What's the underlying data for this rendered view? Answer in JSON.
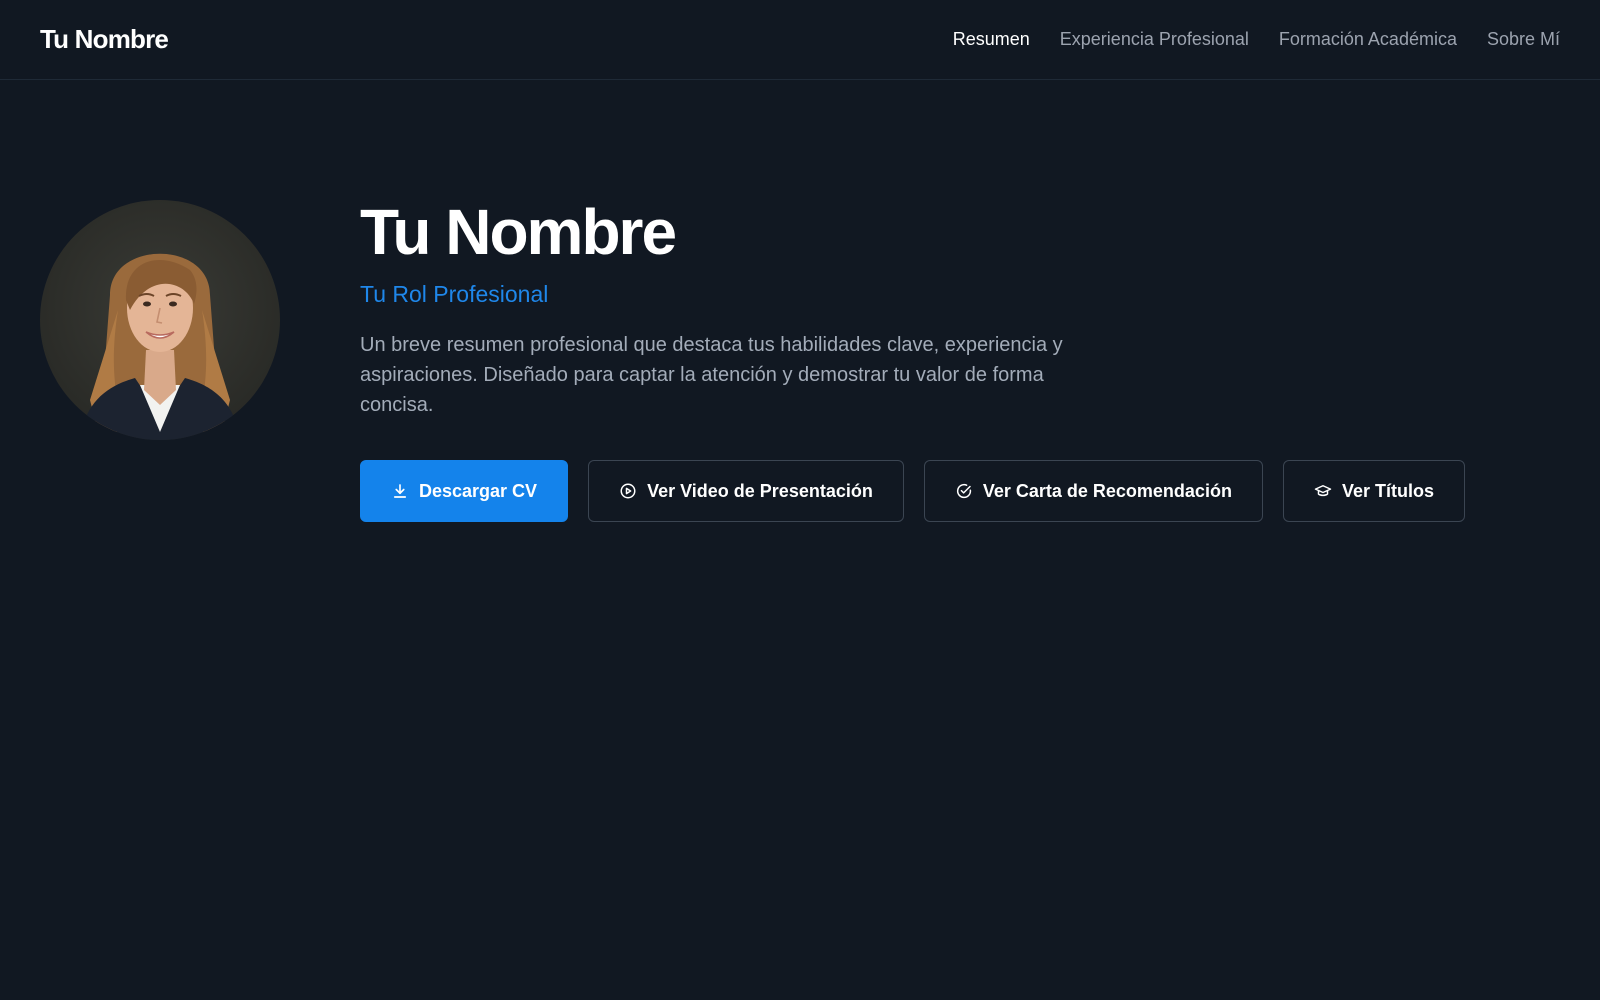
{
  "header": {
    "brand": "Tu Nombre",
    "nav": [
      {
        "label": "Resumen",
        "active": true
      },
      {
        "label": "Experiencia Profesional",
        "active": false
      },
      {
        "label": "Formación Académica",
        "active": false
      },
      {
        "label": "Sobre Mí",
        "active": false
      }
    ]
  },
  "hero": {
    "name": "Tu Nombre",
    "role": "Tu Rol Profesional",
    "summary": "Un breve resumen profesional que destaca tus habilidades clave, experiencia y aspiraciones. Diseñado para captar la atención y demostrar tu valor de forma concisa.",
    "buttons": [
      {
        "label": "Descargar CV",
        "icon": "download-icon",
        "primary": true
      },
      {
        "label": "Ver Video de Presentación",
        "icon": "play-circle-icon",
        "primary": false
      },
      {
        "label": "Ver Carta de Recomendación",
        "icon": "check-circle-icon",
        "primary": false
      },
      {
        "label": "Ver Títulos",
        "icon": "graduation-cap-icon",
        "primary": false
      }
    ]
  },
  "colors": {
    "background": "#111822",
    "accent": "#1483eb",
    "role_text": "#1f87ea",
    "muted_text": "#9ca3af"
  }
}
